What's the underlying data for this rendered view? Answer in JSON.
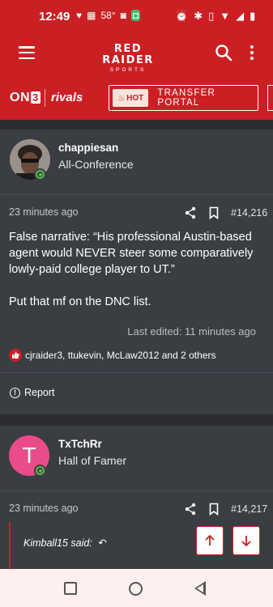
{
  "status_bar": {
    "time": "12:49",
    "temperature": "58°"
  },
  "header": {
    "logo_main": "RED RAIDER",
    "logo_sub": "SPORTS",
    "on3_label": "ON",
    "on3_num": "3",
    "rivals_label": "rivals",
    "hot_label": "HOT",
    "transfer_label": "TRANSFER PORTAL"
  },
  "posts": [
    {
      "username": "chappiesan",
      "user_title": "All-Conference",
      "time": "23 minutes ago",
      "post_number": "#14,216",
      "body": "False narrative: “His professional Austin-based agent would NEVER steer some comparatively lowly-paid college player to UT.”",
      "body2": "Put that mf on the DNC list.",
      "edited": "Last edited: 11 minutes ago",
      "reactions": "cjraider3, ttukevin, McLaw2012 and 2 others",
      "report_label": "Report"
    },
    {
      "username": "TxTchRr",
      "avatar_letter": "T",
      "user_title": "Hall of Famer",
      "time": "23 minutes ago",
      "post_number": "#14,217",
      "quote_author": "Kimball15 said:"
    }
  ],
  "colors": {
    "brand_red": "#cc1f24",
    "card_bg": "#3a3d42",
    "avatar_pink": "#ea4c89",
    "presence_green": "#5cb84d"
  }
}
